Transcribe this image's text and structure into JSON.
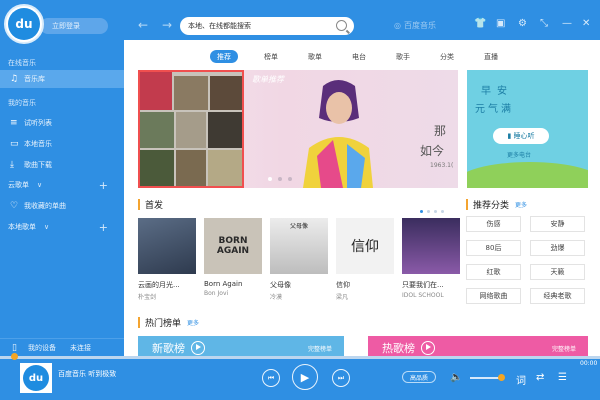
{
  "app": {
    "logo_text": "du",
    "login": "立即登录",
    "search": {
      "value": "本地、在线都能搜索"
    },
    "brand": "百度音乐"
  },
  "sidebar": {
    "online_heading": "在线音乐",
    "music_lib": "音乐库",
    "my_music_heading": "我的音乐",
    "items": [
      "试听列表",
      "本地音乐",
      "歌曲下载"
    ],
    "cloud_heading": "云歌单",
    "favorites": "我收藏的单曲",
    "local_heading": "本地歌单",
    "device": "我的设备",
    "device_status": "未连接"
  },
  "tabs": [
    "推荐",
    "榜单",
    "歌单",
    "电台",
    "歌手",
    "分类",
    "直播"
  ],
  "banner": {
    "tag": "歌单推荐",
    "line1": "那",
    "line2": "如今",
    "date": "1963.1("
  },
  "side_banner": {
    "line1": "早安",
    "line2": "元气满",
    "button": "▮ 睡心听",
    "sub": "更多电台"
  },
  "first_release": {
    "title": "首发",
    "albums": [
      {
        "name": "云画的月光...",
        "artist": "朴宝剑",
        "color": "#5b6d86"
      },
      {
        "name": "Born Again",
        "artist": "Bon Jovi",
        "color": "#c9c3b8"
      },
      {
        "name": "父母像",
        "artist": "冷漠",
        "color": "#d7d7d7"
      },
      {
        "name": "信仰",
        "artist": "梁凡",
        "color": "#e9e9e9"
      },
      {
        "name": "只要我们在...",
        "artist": "IDOL SCHOOL",
        "color": "#5a4a7a"
      }
    ],
    "cover_texts": [
      "",
      "BORN AGAIN",
      "父母像",
      "信仰",
      ""
    ]
  },
  "categories": {
    "title": "推荐分类",
    "more": "更多",
    "items": [
      "伤感",
      "安静",
      "80后",
      "劲爆",
      "红歌",
      "天籁",
      "网络歌曲",
      "经典老歌"
    ]
  },
  "hot_charts": {
    "title": "热门榜单",
    "more": "更多",
    "cards": [
      {
        "name": "新歌榜",
        "full": "完整榜单",
        "color": "#5fb6e6"
      },
      {
        "name": "热歌榜",
        "full": "完整榜单",
        "color": "#ee5ba4"
      }
    ]
  },
  "player": {
    "now_playing": "百度音乐  听到极致",
    "time": "00:00",
    "quality": "高品质",
    "lyrics": "词"
  },
  "colors": {
    "primary": "#2f8fe3",
    "accent": "#f5a623"
  }
}
